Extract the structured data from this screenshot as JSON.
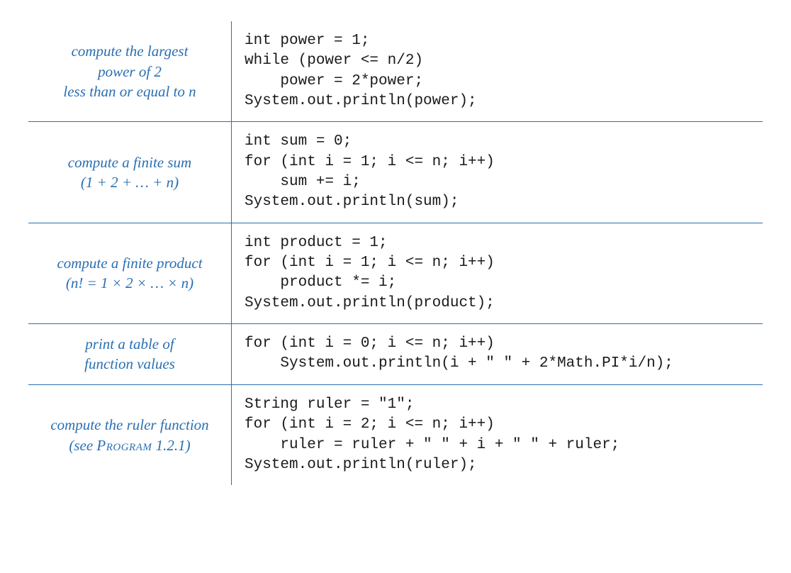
{
  "rows": [
    {
      "desc_html": "compute the largest<br>power of 2<br>less than or equal to n",
      "code": "int power = 1;\nwhile (power <= n/2)\n    power = 2*power;\nSystem.out.println(power);"
    },
    {
      "desc_html": "compute a finite sum<br><span class='sub'>(1 + 2 + … + n)</span>",
      "code": "int sum = 0;\nfor (int i = 1; i <= n; i++)\n    sum += i;\nSystem.out.println(sum);"
    },
    {
      "desc_html": "compute a finite product<br><span class='sub'>(n! = 1 × 2 ×  … × n)</span>",
      "code": "int product = 1;\nfor (int i = 1; i <= n; i++)\n    product *= i;\nSystem.out.println(product);"
    },
    {
      "desc_html": "print a table of<br>function values",
      "code": "for (int i = 0; i <= n; i++)\n    System.out.println(i + \" \" + 2*Math.PI*i/n);"
    },
    {
      "desc_html": "compute the ruler function<br><span class='sub'>(see <span class='smallcaps'>Program</span> 1.2.1)</span>",
      "code": "String ruler = \"1\";\nfor (int i = 2; i <= n; i++)\n    ruler = ruler + \" \" + i + \" \" + ruler;\nSystem.out.println(ruler);"
    }
  ]
}
